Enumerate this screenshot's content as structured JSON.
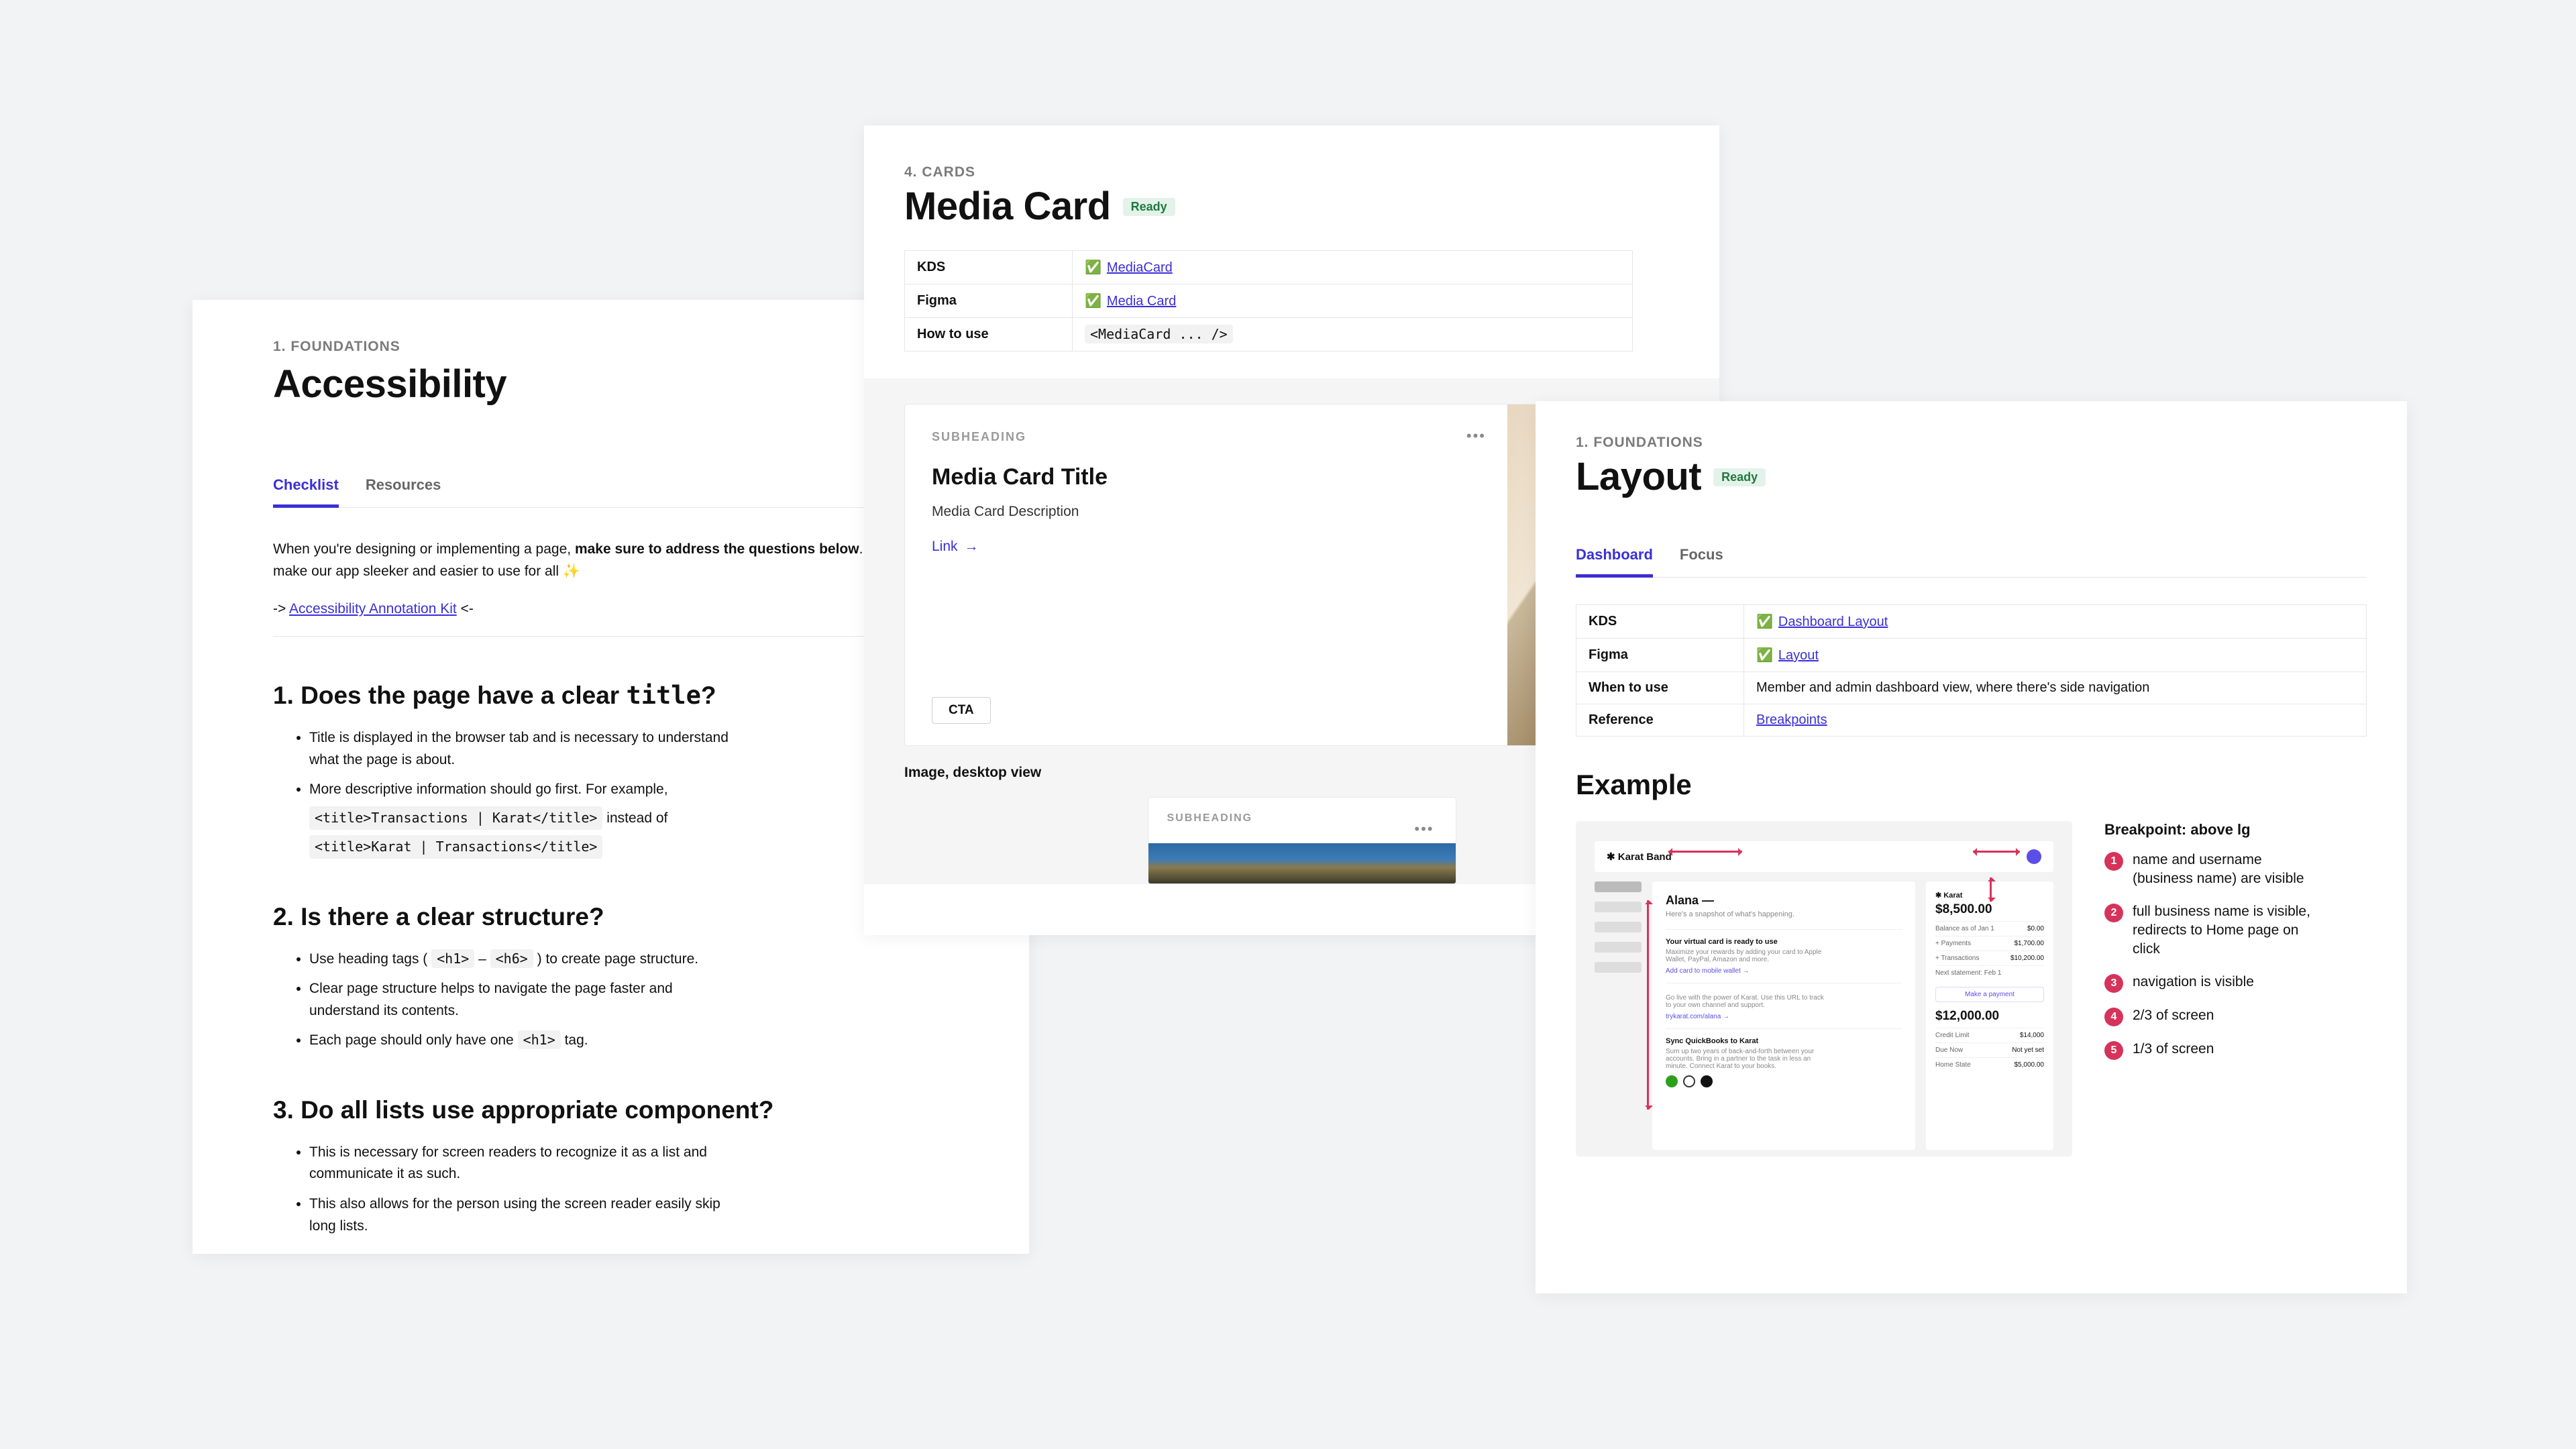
{
  "panel1": {
    "eyebrow": "1. FOUNDATIONS",
    "title": "Accessibility",
    "tabs": {
      "checklist": "Checklist",
      "resources": "Resources"
    },
    "intro_a": "When you're designing or implementing a page, ",
    "intro_b": "make sure to address the questions below",
    "intro_c": ". This will make our app sleeker and easier to use for all ✨",
    "kit_prefix": "-> ",
    "kit_link": "Accessibility Annotation Kit",
    "kit_suffix": " <-",
    "q1_a": "1. Does the page have a clear ",
    "q1_b": "title",
    "q1_c": "?",
    "q1_items": {
      "i0": "Title is displayed in the browser tab and is necessary to understand what the page is about.",
      "i1_a": "More descriptive information should go first. For example,",
      "i1_code1": "<title>Transactions | Karat</title>",
      "i1_mid": " instead of",
      "i1_code2": "<title>Karat | Transactions</title>"
    },
    "q2": "2. Is there a clear structure?",
    "q2_items": {
      "i0_a": "Use heading tags ( ",
      "i0_code1": "<h1>",
      "i0_mid": " – ",
      "i0_code2": "<h6>",
      "i0_b": " ) to create page structure.",
      "i1": "Clear page structure helps to navigate the page faster and understand its contents.",
      "i2_a": "Each page should only have one ",
      "i2_code": "<h1>",
      "i2_b": " tag."
    },
    "q3": "3. Do all lists use appropriate component?",
    "q3_items": {
      "i0": "This is necessary for screen readers to recognize it as a list and communicate it as such.",
      "i1": "This also allows for the person using the screen reader easily skip long lists."
    }
  },
  "panel2": {
    "eyebrow": "4. CARDS",
    "title": "Media Card",
    "badge": "Ready",
    "meta": {
      "kds_label": "KDS",
      "kds_link": "MediaCard",
      "figma_label": "Figma",
      "figma_link": "Media Card",
      "how_label": "How to use",
      "how_code": "<MediaCard ... />"
    },
    "preview": {
      "subheading": "SUBHEADING",
      "title": "Media Card Title",
      "desc": "Media Card Description",
      "link": "Link",
      "cta": "CTA",
      "caption": "Image, desktop view",
      "subheading2": "SUBHEADING"
    }
  },
  "panel3": {
    "eyebrow": "1. FOUNDATIONS",
    "title": "Layout",
    "badge": "Ready",
    "tabs": {
      "dashboard": "Dashboard",
      "focus": "Focus"
    },
    "meta": {
      "kds_label": "KDS",
      "kds_link": "Dashboard Layout",
      "figma_label": "Figma",
      "figma_link": "Layout",
      "when_label": "When to use",
      "when_text": "Member and admin dashboard view, where there's side navigation",
      "ref_label": "Reference",
      "ref_link": "Breakpoints"
    },
    "example_h": "Example",
    "shot": {
      "brand": "✱ Karat Band",
      "name": "Alana —",
      "sub": "Here's a snapshot of what's happening.",
      "b1_t": "Your virtual card is ready to use",
      "b1_d": "Maximize your rewards by adding your card to Apple Wallet, PayPal, Amazon and more.",
      "b1_l": "Add card to mobile wallet →",
      "b2_d": "Go live with the power of Karat. Use this URL to track to your own channel and support.",
      "b2_l": "trykarat.com/alana →",
      "b3_t": "Sync QuickBooks to Karat",
      "b3_d": "Sum up two years of back-and-forth between your accounts. Bring in a partner to the task in less an minute. Connect Karat to your books.",
      "side_brand": "✱ Karat",
      "amt1": "$8,500.00",
      "rows1": {
        "r0l": "Balance as of Jan 1",
        "r0v": "$0.00",
        "r1l": "+ Payments",
        "r1v": "$1,700.00",
        "r2l": "+ Transactions",
        "r2v": "$10,200.00",
        "r3l": "Next statement: Feb 1",
        "r3v": ""
      },
      "btn": "Make a payment",
      "amt2": "$12,000.00",
      "rows2": {
        "r0l": "Credit Limit",
        "r0v": "$14,000",
        "r1l": "Due Now",
        "r1v": "Not yet set",
        "r2l": "Home State",
        "r2v": "$5,000.00"
      }
    },
    "bp_title": "Breakpoint: above lg",
    "bp_items": {
      "i0": "name and username (business name) are visible",
      "i1": "full business name is visible, redirects to Home page on click",
      "i2": "navigation is visible",
      "i3": "2/3 of screen",
      "i4": "1/3 of screen"
    }
  }
}
